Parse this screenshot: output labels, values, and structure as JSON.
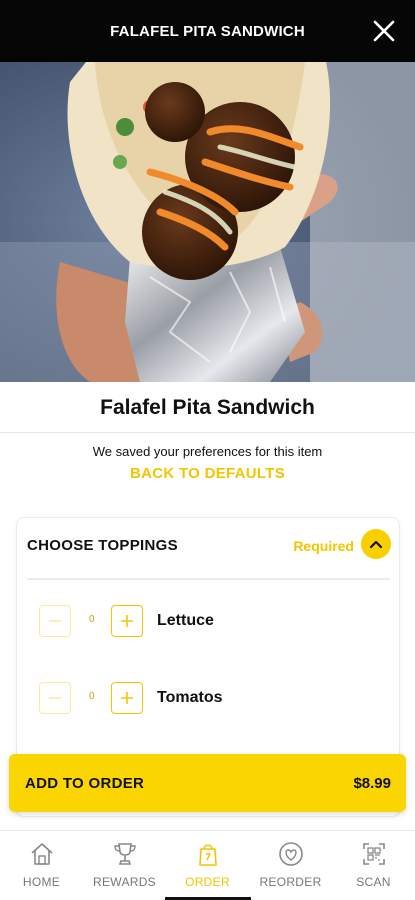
{
  "header": {
    "title": "FALAFEL PITA SANDWICH",
    "close_icon": "close-icon"
  },
  "item": {
    "title": "Falafel Pita Sandwich",
    "preference_note": "We saved your preferences for this item",
    "back_to_defaults": "BACK TO DEFAULTS"
  },
  "toppings": {
    "heading": "CHOOSE TOPPINGS",
    "required_label": "Required",
    "items": [
      {
        "name": "Lettuce",
        "quantity": "0"
      },
      {
        "name": "Tomatos",
        "quantity": "0"
      }
    ]
  },
  "order": {
    "add_label": "ADD TO ORDER",
    "price": "$8.99"
  },
  "nav": {
    "items": [
      {
        "label": "HOME",
        "icon": "home-icon"
      },
      {
        "label": "REWARDS",
        "icon": "trophy-icon"
      },
      {
        "label": "ORDER",
        "icon": "order-bag-icon"
      },
      {
        "label": "REORDER",
        "icon": "heart-badge-icon"
      },
      {
        "label": "SCAN",
        "icon": "qr-scan-icon"
      }
    ],
    "active": "ORDER"
  },
  "colors": {
    "accent": "#f9cf00",
    "header_bg": "#050505",
    "text": "#111111"
  }
}
